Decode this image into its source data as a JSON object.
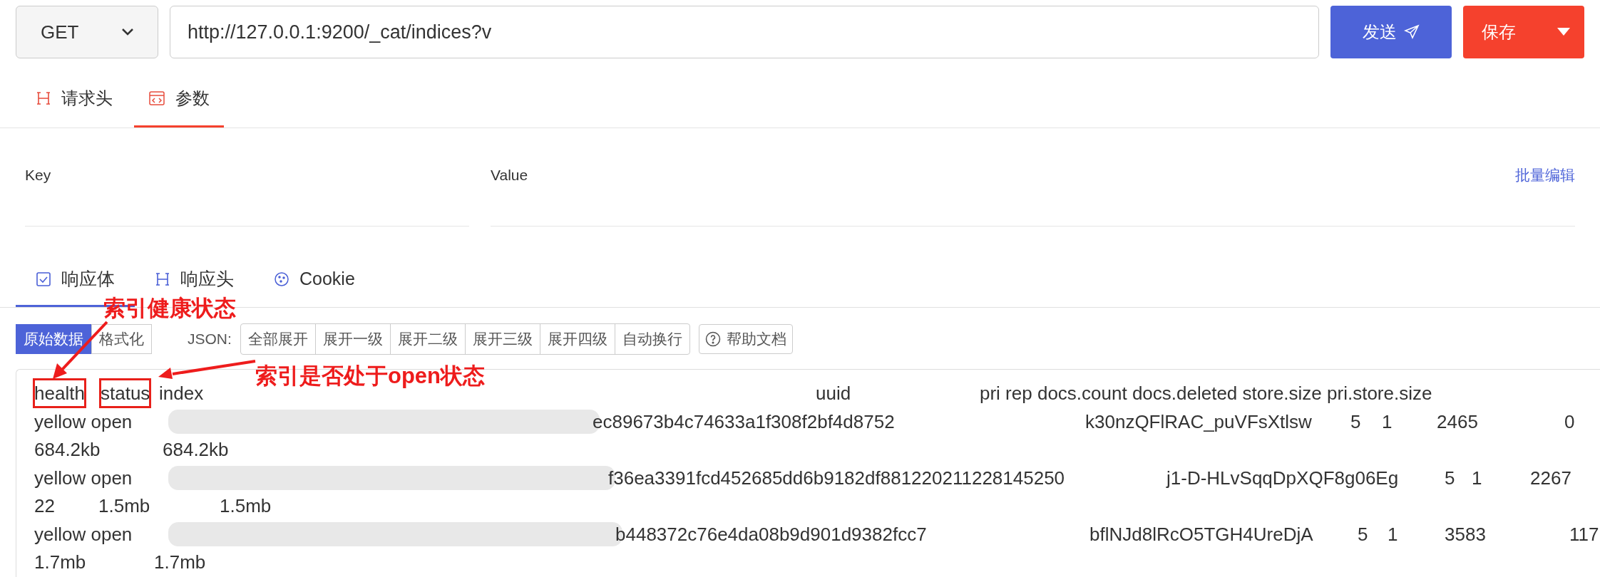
{
  "request": {
    "method": "GET",
    "url": "http://127.0.0.1:9200/_cat/indices?v",
    "send_label": "发送",
    "save_label": "保存"
  },
  "request_tabs": [
    {
      "label": "请求头",
      "selected": false
    },
    {
      "label": "参数",
      "selected": true
    }
  ],
  "params": {
    "columns": [
      "Key",
      "Value"
    ],
    "bulk_edit": "批量编辑"
  },
  "response_tabs": [
    {
      "label": "响应体",
      "selected": true
    },
    {
      "label": "响应头",
      "selected": false
    },
    {
      "label": "Cookie",
      "selected": false
    }
  ],
  "view_modes": [
    {
      "label": "原始数据",
      "selected": true
    },
    {
      "label": "格式化",
      "selected": false
    }
  ],
  "json_label": "JSON:",
  "expand_buttons": [
    "全部展开",
    "展开一级",
    "展开二级",
    "展开三级",
    "展开四级",
    "自动换行"
  ],
  "help_button": "帮助文档",
  "response_lines": [
    [
      {
        "kind": "text",
        "text": "health",
        "boxed": true
      },
      {
        "kind": "text",
        "text": "status",
        "boxed": true
      },
      {
        "kind": "text",
        "text": "index",
        "boxed": false
      },
      {
        "kind": "text",
        "text": "uuid",
        "boxed": false
      },
      {
        "kind": "text",
        "text": "pri rep docs.count docs.deleted store.size pri.store.size",
        "boxed": false
      }
    ],
    [
      {
        "kind": "text",
        "text": "yellow open",
        "boxed": false
      },
      {
        "kind": "redacted"
      },
      {
        "kind": "text",
        "text": "ec89673b4c74633a1f308f2bf4d8752",
        "boxed": false
      },
      {
        "kind": "text",
        "text": "k30nzQFlRAC_puVFsXtlsw",
        "boxed": false
      },
      {
        "kind": "text",
        "text": "5",
        "boxed": false
      },
      {
        "kind": "text",
        "text": "1",
        "boxed": false
      },
      {
        "kind": "text",
        "text": "2465",
        "boxed": false
      },
      {
        "kind": "text",
        "text": "0",
        "boxed": false
      }
    ],
    [
      {
        "kind": "text",
        "text": "684.2kb",
        "boxed": false
      },
      {
        "kind": "text",
        "text": "684.2kb",
        "boxed": false
      }
    ],
    [
      {
        "kind": "text",
        "text": "yellow open",
        "boxed": false
      },
      {
        "kind": "redacted"
      },
      {
        "kind": "text",
        "text": "f36ea3391fcd452685dd6b9182df881220211228145250",
        "boxed": false
      },
      {
        "kind": "text",
        "text": "j1-D-HLvSqqDpXQF8g06Eg",
        "boxed": false
      },
      {
        "kind": "text",
        "text": "5",
        "boxed": false
      },
      {
        "kind": "text",
        "text": "1",
        "boxed": false
      },
      {
        "kind": "text",
        "text": "2267",
        "boxed": false
      }
    ],
    [
      {
        "kind": "text",
        "text": "22",
        "boxed": false
      },
      {
        "kind": "text",
        "text": "1.5mb",
        "boxed": false
      },
      {
        "kind": "text",
        "text": "1.5mb",
        "boxed": false
      }
    ],
    [
      {
        "kind": "text",
        "text": "yellow open",
        "boxed": false
      },
      {
        "kind": "redacted"
      },
      {
        "kind": "text",
        "text": "b448372c76e4da08b9d901d9382fcc7",
        "boxed": false
      },
      {
        "kind": "text",
        "text": "bflNJd8lRcO5TGH4UreDjA",
        "boxed": false
      },
      {
        "kind": "text",
        "text": "5",
        "boxed": false
      },
      {
        "kind": "text",
        "text": "1",
        "boxed": false
      },
      {
        "kind": "text",
        "text": "3583",
        "boxed": false
      },
      {
        "kind": "text",
        "text": "117",
        "boxed": false
      }
    ],
    [
      {
        "kind": "text",
        "text": "1.7mb",
        "boxed": false
      },
      {
        "kind": "text",
        "text": "1.7mb",
        "boxed": false
      }
    ]
  ],
  "annotations": [
    {
      "text": "索引健康状态"
    },
    {
      "text": "索引是否处于open状态"
    }
  ]
}
